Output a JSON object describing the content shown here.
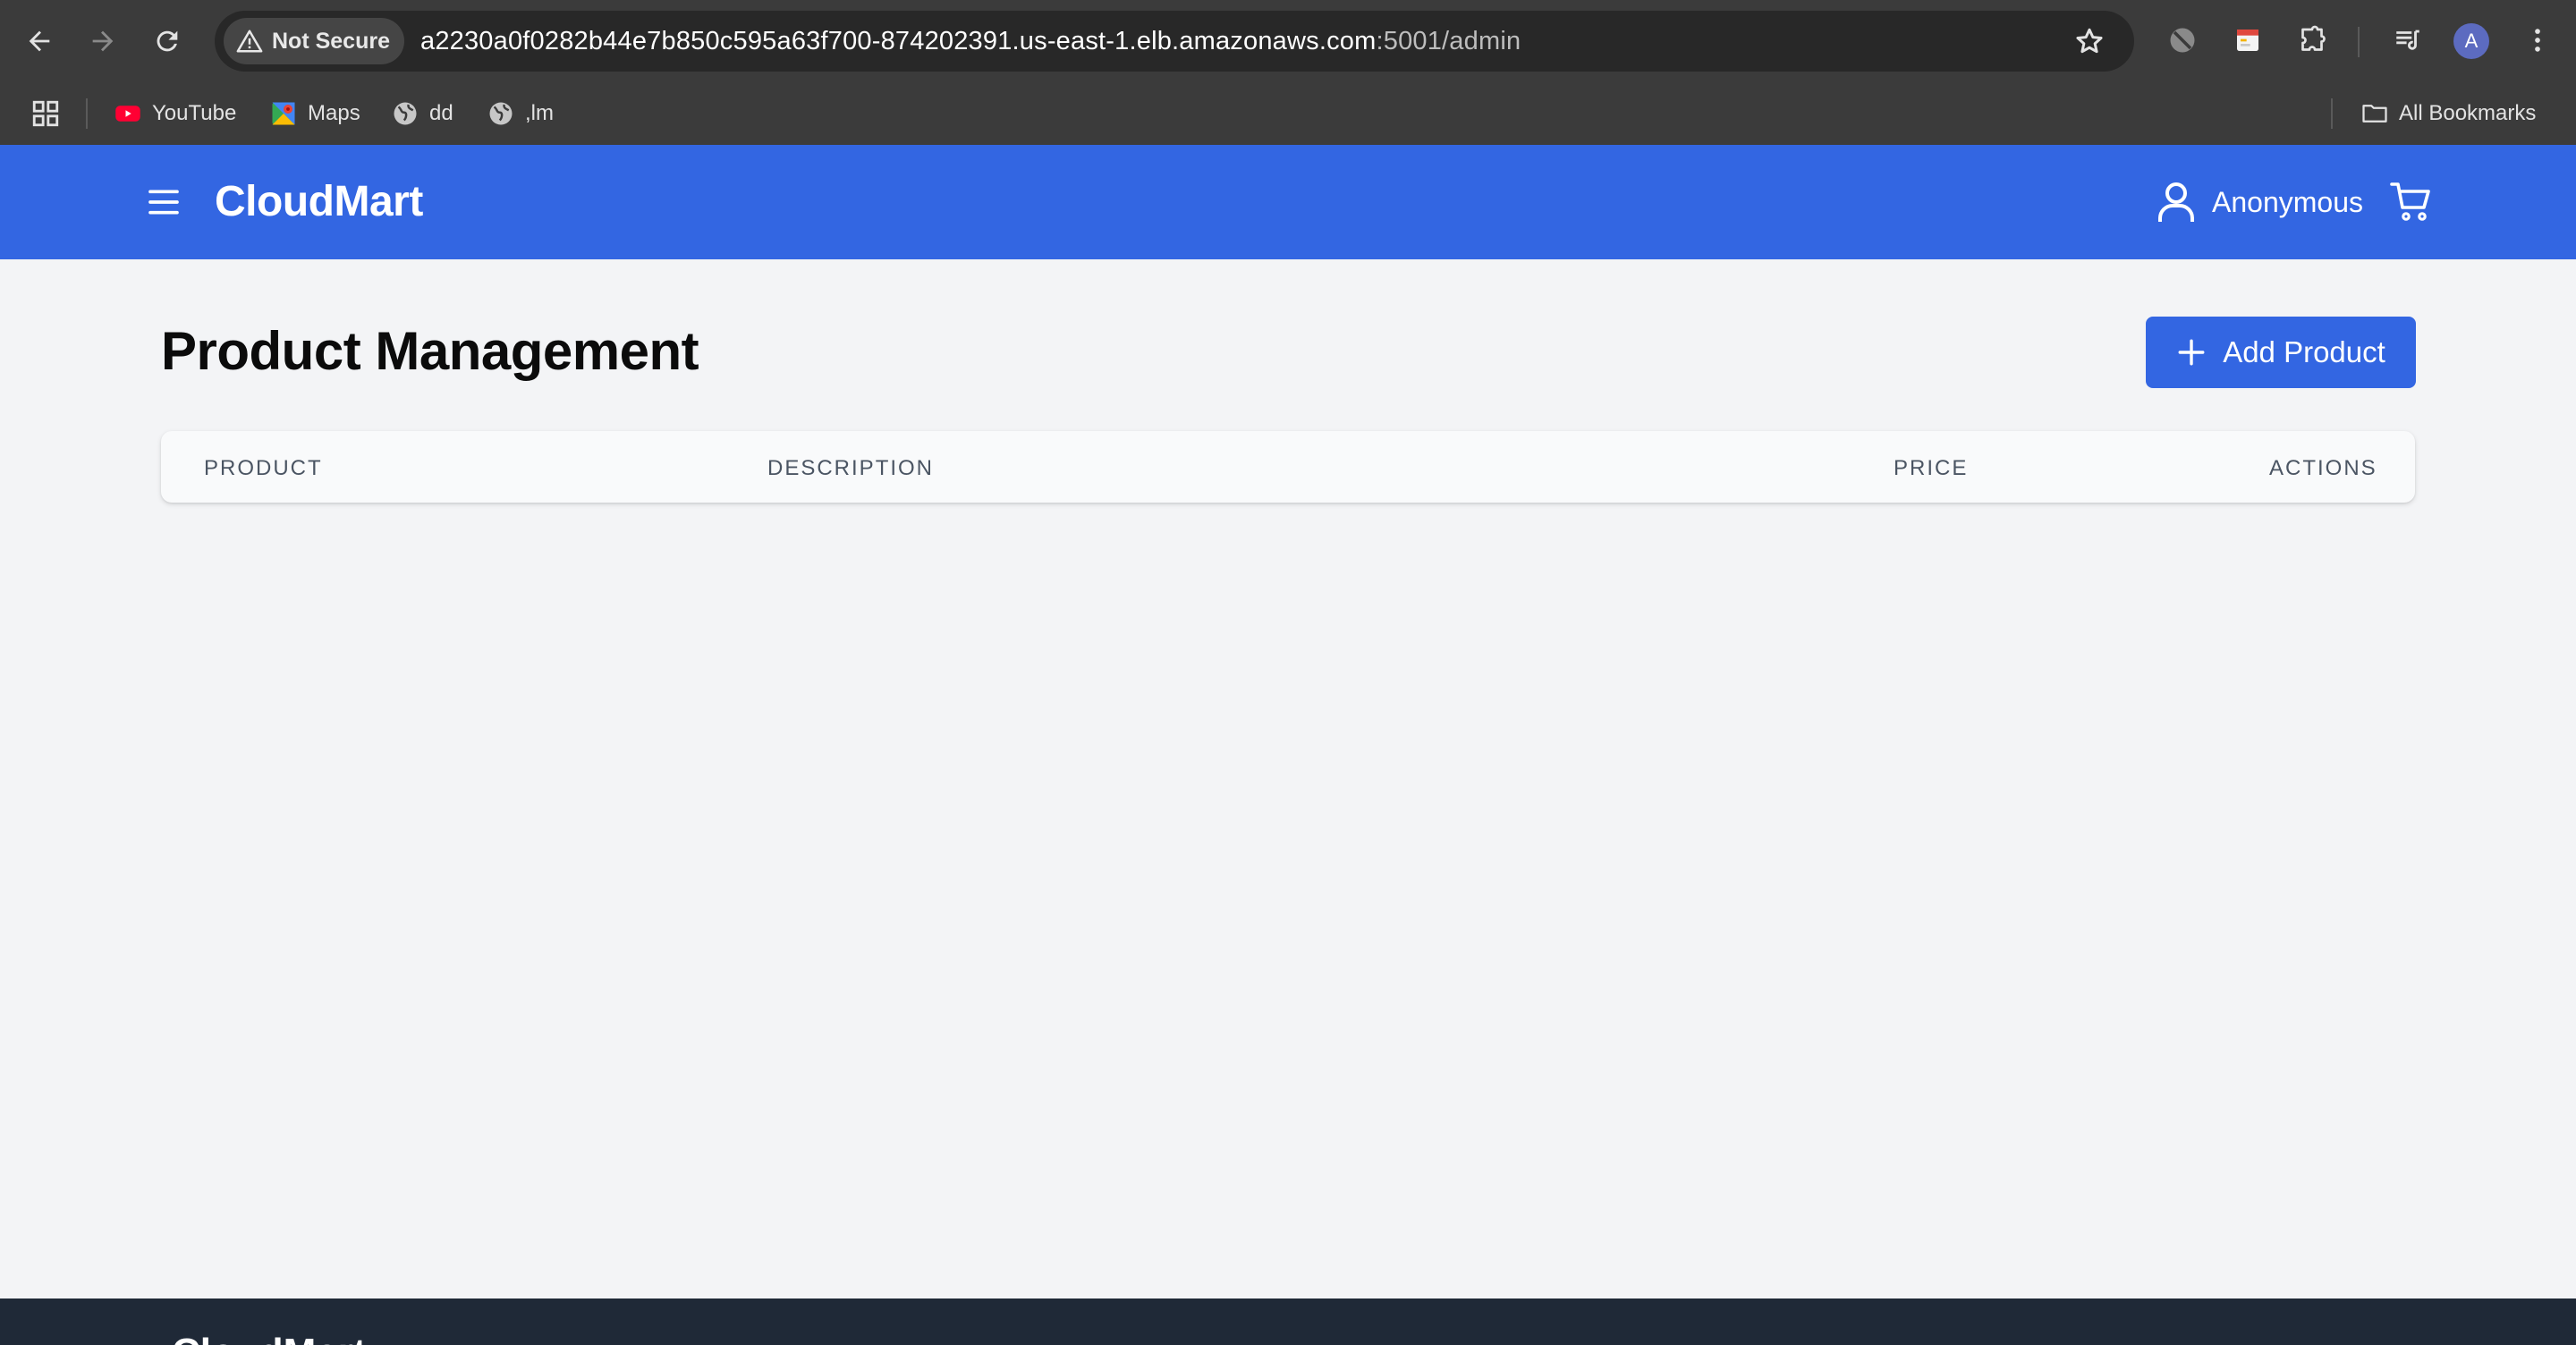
{
  "browser": {
    "security_label": "Not Secure",
    "url_main": "a2230a0f0282b44e7b850c595a63f700-874202391.us-east-1.elb.amazonaws.com",
    "url_dim": ":5001/admin",
    "profile_initial": "A",
    "bookmarks": [
      {
        "label": "YouTube",
        "icon": "youtube-icon"
      },
      {
        "label": "Maps",
        "icon": "maps-icon"
      },
      {
        "label": "dd",
        "icon": "globe-icon"
      },
      {
        "label": ",lm",
        "icon": "globe-icon"
      }
    ],
    "all_bookmarks_label": "All Bookmarks"
  },
  "header": {
    "brand": "CloudMart",
    "user_name": "Anonymous",
    "bg_color": "#3366e2"
  },
  "main": {
    "title": "Product Management",
    "add_button_label": "Add Product",
    "table_columns": [
      "PRODUCT",
      "DESCRIPTION",
      "PRICE",
      "ACTIONS"
    ]
  },
  "footer": {
    "brand": "CloudMart"
  }
}
